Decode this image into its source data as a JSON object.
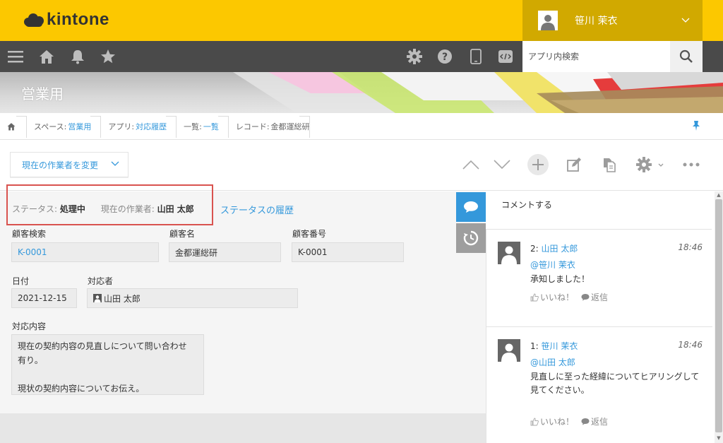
{
  "header": {
    "logo_text": "kintone",
    "user_name": "笹川 茉衣"
  },
  "nav": {
    "search_placeholder": "アプリ内検索"
  },
  "banner": {
    "title": "営業用"
  },
  "breadcrumb": {
    "space_label": "スペース:",
    "space_value": "営業用",
    "app_label": "アプリ:",
    "app_value": "対応履歴",
    "list_label": "一覧:",
    "list_value": "一覧",
    "record_label": "レコード:",
    "record_value": "金都運総研"
  },
  "toolbar": {
    "action_label": "現在の作業者を変更"
  },
  "status": {
    "status_label": "ステータス:",
    "status_value": "処理中",
    "assignee_label": "現在の作業者:",
    "assignee_value": "山田 太郎",
    "history_link": "ステータスの履歴"
  },
  "fields": {
    "customer_search_label": "顧客検索",
    "customer_search_value": "K-0001",
    "customer_name_label": "顧客名",
    "customer_name_value": "金都運総研",
    "customer_no_label": "顧客番号",
    "customer_no_value": "K-0001",
    "date_label": "日付",
    "date_value": "2021-12-15",
    "handler_label": "対応者",
    "handler_value": "山田 太郎",
    "content_label": "対応内容",
    "content_line1": "現在の契約内容の見直しについて問い合わせ",
    "content_line2": "有り。",
    "content_line3": "",
    "content_line4": "現状の契約内容についてお伝え。"
  },
  "comments": {
    "input_placeholder": "コメントする",
    "items": [
      {
        "number": "2:",
        "user": "山田 太郎",
        "time": "18:46",
        "mention": "@笹川 茉衣",
        "body": "承知しました！",
        "like": "いいね！",
        "reply": "返信"
      },
      {
        "number": "1:",
        "user": "笹川 茉衣",
        "time": "18:46",
        "mention": "@山田 太郎",
        "body": "見直しに至った経緯についてヒアリングして見てください。",
        "like": "いいね！",
        "reply": "返信"
      }
    ]
  },
  "colors": {
    "header_yellow": "#fcc800",
    "nav_dark": "#4a4a4a",
    "link_blue": "#3498db",
    "highlight_red": "#d9534f"
  }
}
